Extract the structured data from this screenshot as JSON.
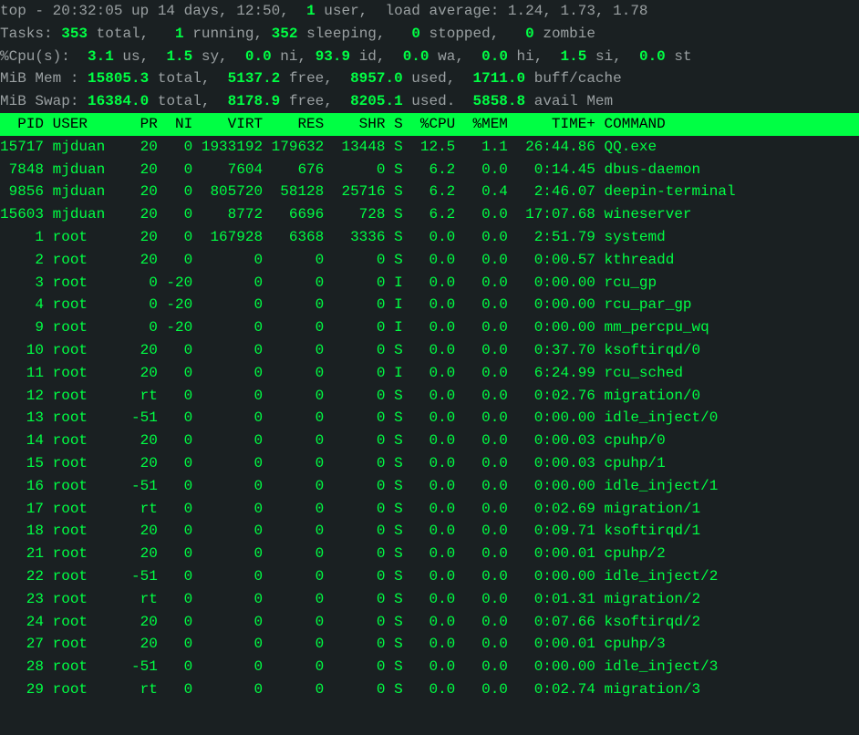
{
  "summary": {
    "line1": {
      "prefix": "top - ",
      "time": "20:32:05",
      "up_label": " up ",
      "up": "14 days, 12:50",
      "sep1": ",  ",
      "users": "1",
      "users_label": " user,  ",
      "load_label": "load average: ",
      "load1": "1.24",
      "c1": ", ",
      "load5": "1.73",
      "c2": ", ",
      "load15": "1.78"
    },
    "tasks": {
      "label": "Tasks: ",
      "total": "353",
      "total_l": " total,   ",
      "running": "1",
      "running_l": " running, ",
      "sleeping": "352",
      "sleeping_l": " sleeping,   ",
      "stopped": "0",
      "stopped_l": " stopped,   ",
      "zombie": "0",
      "zombie_l": " zombie"
    },
    "cpu": {
      "label": "%Cpu(s):  ",
      "us": "3.1",
      "us_l": " us,  ",
      "sy": "1.5",
      "sy_l": " sy,  ",
      "ni": "0.0",
      "ni_l": " ni, ",
      "id": "93.9",
      "id_l": " id,  ",
      "wa": "0.0",
      "wa_l": " wa,  ",
      "hi": "0.0",
      "hi_l": " hi,  ",
      "si": "1.5",
      "si_l": " si,  ",
      "st": "0.0",
      "st_l": " st"
    },
    "mem": {
      "label": "MiB Mem : ",
      "total": "15805.3",
      "total_l": " total,  ",
      "free": "5137.2",
      "free_l": " free,  ",
      "used": "8957.0",
      "used_l": " used,  ",
      "buff": "1711.0",
      "buff_l": " buff/cache"
    },
    "swap": {
      "label": "MiB Swap: ",
      "total": "16384.0",
      "total_l": " total,  ",
      "free": "8178.9",
      "free_l": " free,  ",
      "used": "8205.1",
      "used_l": " used.  ",
      "avail": "5858.8",
      "avail_l": " avail Mem"
    }
  },
  "columns": [
    "PID",
    "USER",
    "PR",
    "NI",
    "VIRT",
    "RES",
    "SHR",
    "S",
    "%CPU",
    "%MEM",
    "TIME+",
    "COMMAND"
  ],
  "processes": [
    {
      "pid": "15717",
      "user": "mjduan",
      "pr": "20",
      "ni": "0",
      "virt": "1933192",
      "res": "179632",
      "shr": "13448",
      "s": "S",
      "cpu": "12.5",
      "mem": "1.1",
      "time": "26:44.86",
      "cmd": "QQ.exe"
    },
    {
      "pid": "7848",
      "user": "mjduan",
      "pr": "20",
      "ni": "0",
      "virt": "7604",
      "res": "676",
      "shr": "0",
      "s": "S",
      "cpu": "6.2",
      "mem": "0.0",
      "time": "0:14.45",
      "cmd": "dbus-daemon"
    },
    {
      "pid": "9856",
      "user": "mjduan",
      "pr": "20",
      "ni": "0",
      "virt": "805720",
      "res": "58128",
      "shr": "25716",
      "s": "S",
      "cpu": "6.2",
      "mem": "0.4",
      "time": "2:46.07",
      "cmd": "deepin-terminal"
    },
    {
      "pid": "15603",
      "user": "mjduan",
      "pr": "20",
      "ni": "0",
      "virt": "8772",
      "res": "6696",
      "shr": "728",
      "s": "S",
      "cpu": "6.2",
      "mem": "0.0",
      "time": "17:07.68",
      "cmd": "wineserver"
    },
    {
      "pid": "1",
      "user": "root",
      "pr": "20",
      "ni": "0",
      "virt": "167928",
      "res": "6368",
      "shr": "3336",
      "s": "S",
      "cpu": "0.0",
      "mem": "0.0",
      "time": "2:51.79",
      "cmd": "systemd"
    },
    {
      "pid": "2",
      "user": "root",
      "pr": "20",
      "ni": "0",
      "virt": "0",
      "res": "0",
      "shr": "0",
      "s": "S",
      "cpu": "0.0",
      "mem": "0.0",
      "time": "0:00.57",
      "cmd": "kthreadd"
    },
    {
      "pid": "3",
      "user": "root",
      "pr": "0",
      "ni": "-20",
      "virt": "0",
      "res": "0",
      "shr": "0",
      "s": "I",
      "cpu": "0.0",
      "mem": "0.0",
      "time": "0:00.00",
      "cmd": "rcu_gp"
    },
    {
      "pid": "4",
      "user": "root",
      "pr": "0",
      "ni": "-20",
      "virt": "0",
      "res": "0",
      "shr": "0",
      "s": "I",
      "cpu": "0.0",
      "mem": "0.0",
      "time": "0:00.00",
      "cmd": "rcu_par_gp"
    },
    {
      "pid": "9",
      "user": "root",
      "pr": "0",
      "ni": "-20",
      "virt": "0",
      "res": "0",
      "shr": "0",
      "s": "I",
      "cpu": "0.0",
      "mem": "0.0",
      "time": "0:00.00",
      "cmd": "mm_percpu_wq"
    },
    {
      "pid": "10",
      "user": "root",
      "pr": "20",
      "ni": "0",
      "virt": "0",
      "res": "0",
      "shr": "0",
      "s": "S",
      "cpu": "0.0",
      "mem": "0.0",
      "time": "0:37.70",
      "cmd": "ksoftirqd/0"
    },
    {
      "pid": "11",
      "user": "root",
      "pr": "20",
      "ni": "0",
      "virt": "0",
      "res": "0",
      "shr": "0",
      "s": "I",
      "cpu": "0.0",
      "mem": "0.0",
      "time": "6:24.99",
      "cmd": "rcu_sched"
    },
    {
      "pid": "12",
      "user": "root",
      "pr": "rt",
      "ni": "0",
      "virt": "0",
      "res": "0",
      "shr": "0",
      "s": "S",
      "cpu": "0.0",
      "mem": "0.0",
      "time": "0:02.76",
      "cmd": "migration/0"
    },
    {
      "pid": "13",
      "user": "root",
      "pr": "-51",
      "ni": "0",
      "virt": "0",
      "res": "0",
      "shr": "0",
      "s": "S",
      "cpu": "0.0",
      "mem": "0.0",
      "time": "0:00.00",
      "cmd": "idle_inject/0"
    },
    {
      "pid": "14",
      "user": "root",
      "pr": "20",
      "ni": "0",
      "virt": "0",
      "res": "0",
      "shr": "0",
      "s": "S",
      "cpu": "0.0",
      "mem": "0.0",
      "time": "0:00.03",
      "cmd": "cpuhp/0"
    },
    {
      "pid": "15",
      "user": "root",
      "pr": "20",
      "ni": "0",
      "virt": "0",
      "res": "0",
      "shr": "0",
      "s": "S",
      "cpu": "0.0",
      "mem": "0.0",
      "time": "0:00.03",
      "cmd": "cpuhp/1"
    },
    {
      "pid": "16",
      "user": "root",
      "pr": "-51",
      "ni": "0",
      "virt": "0",
      "res": "0",
      "shr": "0",
      "s": "S",
      "cpu": "0.0",
      "mem": "0.0",
      "time": "0:00.00",
      "cmd": "idle_inject/1"
    },
    {
      "pid": "17",
      "user": "root",
      "pr": "rt",
      "ni": "0",
      "virt": "0",
      "res": "0",
      "shr": "0",
      "s": "S",
      "cpu": "0.0",
      "mem": "0.0",
      "time": "0:02.69",
      "cmd": "migration/1"
    },
    {
      "pid": "18",
      "user": "root",
      "pr": "20",
      "ni": "0",
      "virt": "0",
      "res": "0",
      "shr": "0",
      "s": "S",
      "cpu": "0.0",
      "mem": "0.0",
      "time": "0:09.71",
      "cmd": "ksoftirqd/1"
    },
    {
      "pid": "21",
      "user": "root",
      "pr": "20",
      "ni": "0",
      "virt": "0",
      "res": "0",
      "shr": "0",
      "s": "S",
      "cpu": "0.0",
      "mem": "0.0",
      "time": "0:00.01",
      "cmd": "cpuhp/2"
    },
    {
      "pid": "22",
      "user": "root",
      "pr": "-51",
      "ni": "0",
      "virt": "0",
      "res": "0",
      "shr": "0",
      "s": "S",
      "cpu": "0.0",
      "mem": "0.0",
      "time": "0:00.00",
      "cmd": "idle_inject/2"
    },
    {
      "pid": "23",
      "user": "root",
      "pr": "rt",
      "ni": "0",
      "virt": "0",
      "res": "0",
      "shr": "0",
      "s": "S",
      "cpu": "0.0",
      "mem": "0.0",
      "time": "0:01.31",
      "cmd": "migration/2"
    },
    {
      "pid": "24",
      "user": "root",
      "pr": "20",
      "ni": "0",
      "virt": "0",
      "res": "0",
      "shr": "0",
      "s": "S",
      "cpu": "0.0",
      "mem": "0.0",
      "time": "0:07.66",
      "cmd": "ksoftirqd/2"
    },
    {
      "pid": "27",
      "user": "root",
      "pr": "20",
      "ni": "0",
      "virt": "0",
      "res": "0",
      "shr": "0",
      "s": "S",
      "cpu": "0.0",
      "mem": "0.0",
      "time": "0:00.01",
      "cmd": "cpuhp/3"
    },
    {
      "pid": "28",
      "user": "root",
      "pr": "-51",
      "ni": "0",
      "virt": "0",
      "res": "0",
      "shr": "0",
      "s": "S",
      "cpu": "0.0",
      "mem": "0.0",
      "time": "0:00.00",
      "cmd": "idle_inject/3"
    },
    {
      "pid": "29",
      "user": "root",
      "pr": "rt",
      "ni": "0",
      "virt": "0",
      "res": "0",
      "shr": "0",
      "s": "S",
      "cpu": "0.0",
      "mem": "0.0",
      "time": "0:02.74",
      "cmd": "migration/3"
    }
  ]
}
